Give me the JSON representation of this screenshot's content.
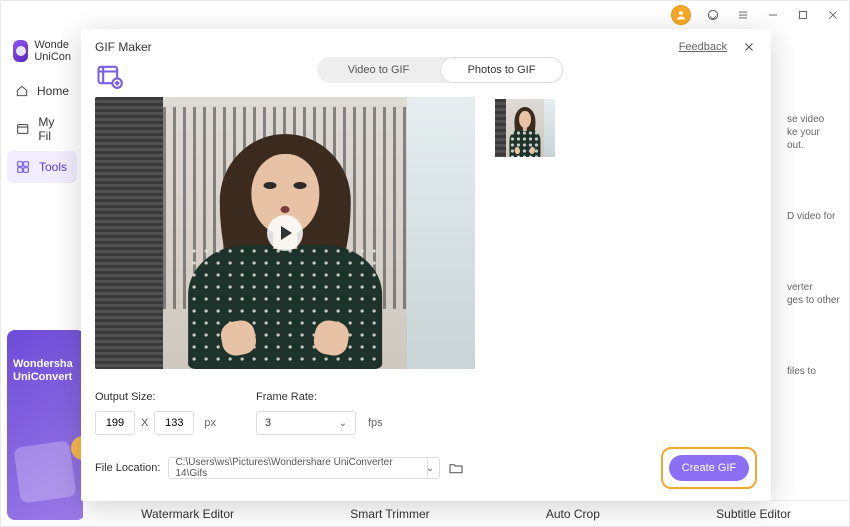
{
  "app": {
    "name": "Wondershare UniConverter",
    "name_short_1": "Wonde",
    "name_short_2": "UniCon"
  },
  "window_controls": {
    "minimize": "−",
    "maximize": "□",
    "close": "×"
  },
  "nav": {
    "items": [
      {
        "label": "Home"
      },
      {
        "label": "My Fil"
      },
      {
        "label": "Tools"
      }
    ]
  },
  "promo": {
    "line1": "Wondersha",
    "line2": "UniConvert"
  },
  "content_hints": {
    "h1": "se video\nke your\nout.",
    "h2": "D video for",
    "h3": "verter\nges to other",
    "h4": "files to"
  },
  "bottom_tools": [
    "Watermark Editor",
    "Smart Trimmer",
    "Auto Crop",
    "Subtitle Editor"
  ],
  "modal": {
    "title": "GIF Maker",
    "feedback": "Feedback",
    "tabs": {
      "video": "Video to GIF",
      "photos": "Photos to GIF"
    },
    "output_size_label": "Output Size:",
    "width": "199",
    "height": "133",
    "size_unit": "px",
    "size_x": "X",
    "frame_rate_label": "Frame Rate:",
    "frame_rate_value": "3",
    "frame_rate_unit": "fps",
    "file_location_label": "File Location:",
    "file_location_value": "C:\\Users\\ws\\Pictures\\Wondershare UniConverter 14\\Gifs",
    "create_label": "Create GIF"
  }
}
